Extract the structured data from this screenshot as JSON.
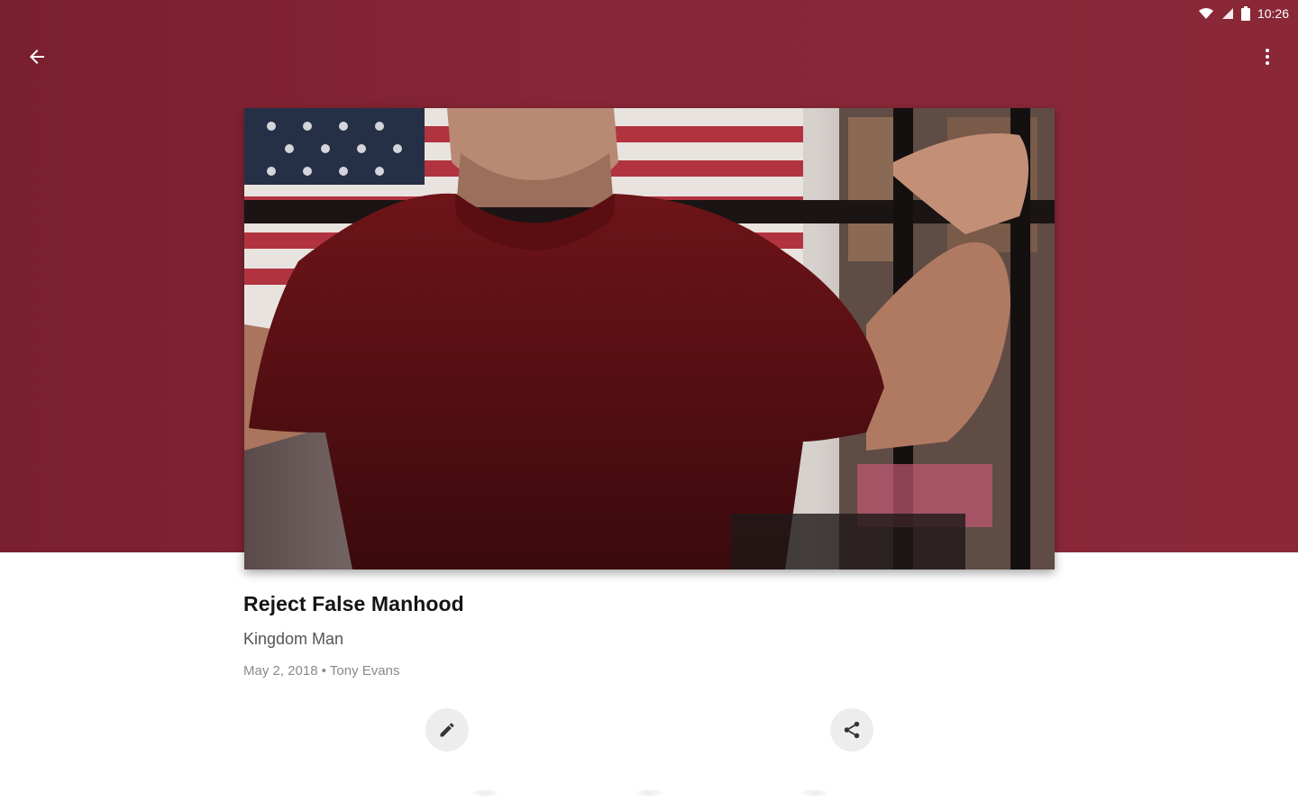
{
  "status_bar": {
    "time": "10:26",
    "icons": [
      "wifi-icon",
      "cell-signal-icon",
      "battery-icon"
    ]
  },
  "app_bar": {
    "back_icon": "arrow-back-icon",
    "menu_icon": "more-vert-icon"
  },
  "colors": {
    "accent": "#862636",
    "title": "#151515",
    "subtitle": "#555555",
    "meta": "#8a8a8a"
  },
  "sermon": {
    "title": "Reject False Manhood",
    "series": "Kingdom Man",
    "date": "May 2, 2018",
    "separator": "•",
    "speaker": "Tony Evans",
    "image_icon": "sermon-artwork"
  },
  "actions": {
    "edit_icon": "pencil-icon",
    "share_icon": "share-icon"
  }
}
